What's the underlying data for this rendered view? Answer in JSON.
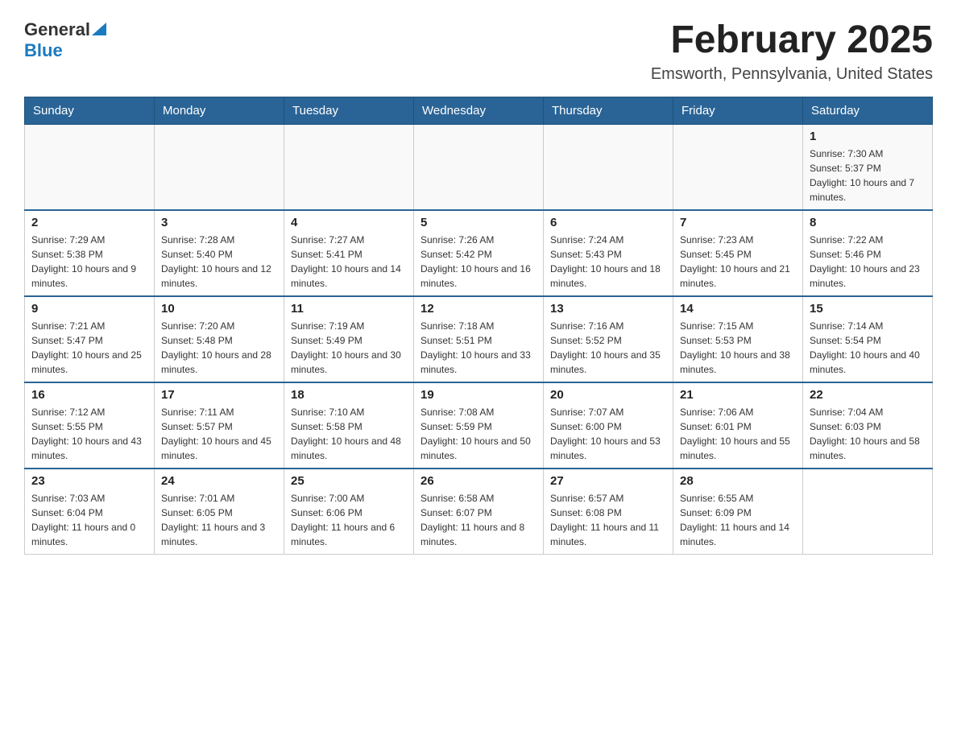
{
  "header": {
    "logo_general": "General",
    "logo_blue": "Blue",
    "month_title": "February 2025",
    "location": "Emsworth, Pennsylvania, United States"
  },
  "days_of_week": [
    "Sunday",
    "Monday",
    "Tuesday",
    "Wednesday",
    "Thursday",
    "Friday",
    "Saturday"
  ],
  "weeks": [
    [
      {
        "day": "",
        "info": ""
      },
      {
        "day": "",
        "info": ""
      },
      {
        "day": "",
        "info": ""
      },
      {
        "day": "",
        "info": ""
      },
      {
        "day": "",
        "info": ""
      },
      {
        "day": "",
        "info": ""
      },
      {
        "day": "1",
        "info": "Sunrise: 7:30 AM\nSunset: 5:37 PM\nDaylight: 10 hours and 7 minutes."
      }
    ],
    [
      {
        "day": "2",
        "info": "Sunrise: 7:29 AM\nSunset: 5:38 PM\nDaylight: 10 hours and 9 minutes."
      },
      {
        "day": "3",
        "info": "Sunrise: 7:28 AM\nSunset: 5:40 PM\nDaylight: 10 hours and 12 minutes."
      },
      {
        "day": "4",
        "info": "Sunrise: 7:27 AM\nSunset: 5:41 PM\nDaylight: 10 hours and 14 minutes."
      },
      {
        "day": "5",
        "info": "Sunrise: 7:26 AM\nSunset: 5:42 PM\nDaylight: 10 hours and 16 minutes."
      },
      {
        "day": "6",
        "info": "Sunrise: 7:24 AM\nSunset: 5:43 PM\nDaylight: 10 hours and 18 minutes."
      },
      {
        "day": "7",
        "info": "Sunrise: 7:23 AM\nSunset: 5:45 PM\nDaylight: 10 hours and 21 minutes."
      },
      {
        "day": "8",
        "info": "Sunrise: 7:22 AM\nSunset: 5:46 PM\nDaylight: 10 hours and 23 minutes."
      }
    ],
    [
      {
        "day": "9",
        "info": "Sunrise: 7:21 AM\nSunset: 5:47 PM\nDaylight: 10 hours and 25 minutes."
      },
      {
        "day": "10",
        "info": "Sunrise: 7:20 AM\nSunset: 5:48 PM\nDaylight: 10 hours and 28 minutes."
      },
      {
        "day": "11",
        "info": "Sunrise: 7:19 AM\nSunset: 5:49 PM\nDaylight: 10 hours and 30 minutes."
      },
      {
        "day": "12",
        "info": "Sunrise: 7:18 AM\nSunset: 5:51 PM\nDaylight: 10 hours and 33 minutes."
      },
      {
        "day": "13",
        "info": "Sunrise: 7:16 AM\nSunset: 5:52 PM\nDaylight: 10 hours and 35 minutes."
      },
      {
        "day": "14",
        "info": "Sunrise: 7:15 AM\nSunset: 5:53 PM\nDaylight: 10 hours and 38 minutes."
      },
      {
        "day": "15",
        "info": "Sunrise: 7:14 AM\nSunset: 5:54 PM\nDaylight: 10 hours and 40 minutes."
      }
    ],
    [
      {
        "day": "16",
        "info": "Sunrise: 7:12 AM\nSunset: 5:55 PM\nDaylight: 10 hours and 43 minutes."
      },
      {
        "day": "17",
        "info": "Sunrise: 7:11 AM\nSunset: 5:57 PM\nDaylight: 10 hours and 45 minutes."
      },
      {
        "day": "18",
        "info": "Sunrise: 7:10 AM\nSunset: 5:58 PM\nDaylight: 10 hours and 48 minutes."
      },
      {
        "day": "19",
        "info": "Sunrise: 7:08 AM\nSunset: 5:59 PM\nDaylight: 10 hours and 50 minutes."
      },
      {
        "day": "20",
        "info": "Sunrise: 7:07 AM\nSunset: 6:00 PM\nDaylight: 10 hours and 53 minutes."
      },
      {
        "day": "21",
        "info": "Sunrise: 7:06 AM\nSunset: 6:01 PM\nDaylight: 10 hours and 55 minutes."
      },
      {
        "day": "22",
        "info": "Sunrise: 7:04 AM\nSunset: 6:03 PM\nDaylight: 10 hours and 58 minutes."
      }
    ],
    [
      {
        "day": "23",
        "info": "Sunrise: 7:03 AM\nSunset: 6:04 PM\nDaylight: 11 hours and 0 minutes."
      },
      {
        "day": "24",
        "info": "Sunrise: 7:01 AM\nSunset: 6:05 PM\nDaylight: 11 hours and 3 minutes."
      },
      {
        "day": "25",
        "info": "Sunrise: 7:00 AM\nSunset: 6:06 PM\nDaylight: 11 hours and 6 minutes."
      },
      {
        "day": "26",
        "info": "Sunrise: 6:58 AM\nSunset: 6:07 PM\nDaylight: 11 hours and 8 minutes."
      },
      {
        "day": "27",
        "info": "Sunrise: 6:57 AM\nSunset: 6:08 PM\nDaylight: 11 hours and 11 minutes."
      },
      {
        "day": "28",
        "info": "Sunrise: 6:55 AM\nSunset: 6:09 PM\nDaylight: 11 hours and 14 minutes."
      },
      {
        "day": "",
        "info": ""
      }
    ]
  ]
}
